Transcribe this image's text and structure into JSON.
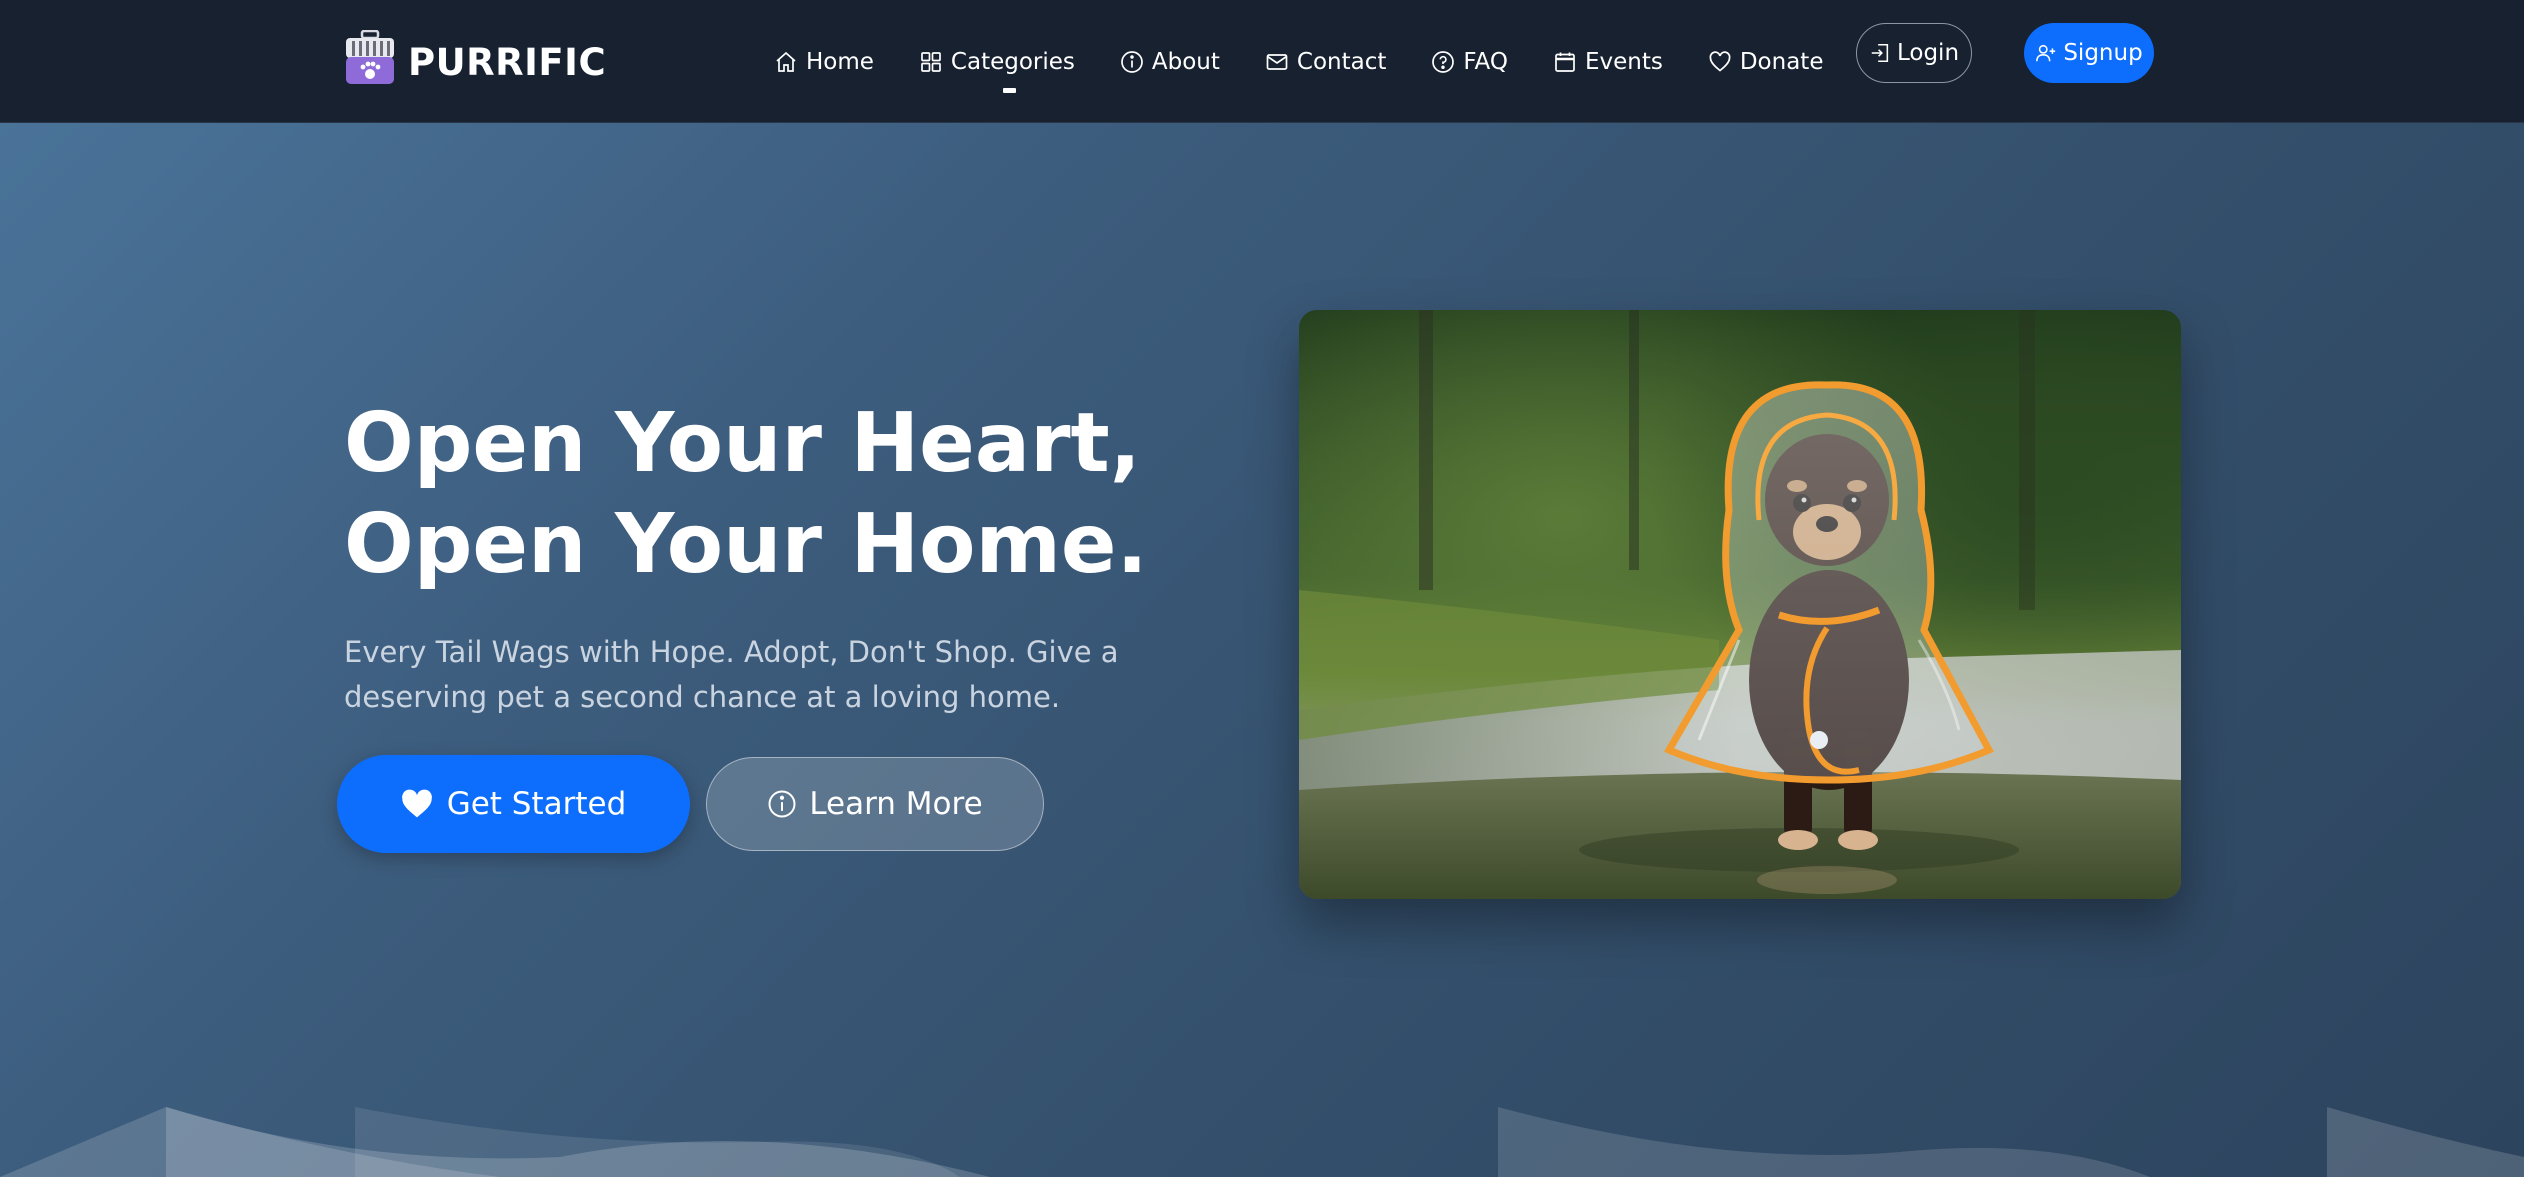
{
  "brand": {
    "name": "PURRIFIC",
    "logo_icon": "pet-carrier-icon"
  },
  "nav": {
    "items": [
      {
        "label": "Home",
        "icon": "house-icon"
      },
      {
        "label": "Categories",
        "icon": "grid-icon",
        "active": true
      },
      {
        "label": "About",
        "icon": "info-icon"
      },
      {
        "label": "Contact",
        "icon": "envelope-icon"
      },
      {
        "label": "FAQ",
        "icon": "question-icon"
      },
      {
        "label": "Events",
        "icon": "calendar-icon"
      },
      {
        "label": "Donate",
        "icon": "heart-icon"
      }
    ],
    "login_label": "Login",
    "signup_label": "Signup"
  },
  "hero": {
    "headline_line1": "Open Your Heart,",
    "headline_line2": "Open Your Home.",
    "subtext": "Every Tail Wags with Hope. Adopt, Don't Shop. Give a deserving pet a second chance at a loving home.",
    "primary_button": "Get Started",
    "secondary_button": "Learn More",
    "image_alt": "Small chihuahua wearing a transparent raincoat with orange trim standing on a wet path"
  },
  "colors": {
    "navbar_bg": "#172130",
    "accent": "#0d6efd",
    "hero_bg_start": "#4a7399",
    "hero_bg_end": "#2d445e",
    "logo_purple": "#8e6bd8"
  }
}
